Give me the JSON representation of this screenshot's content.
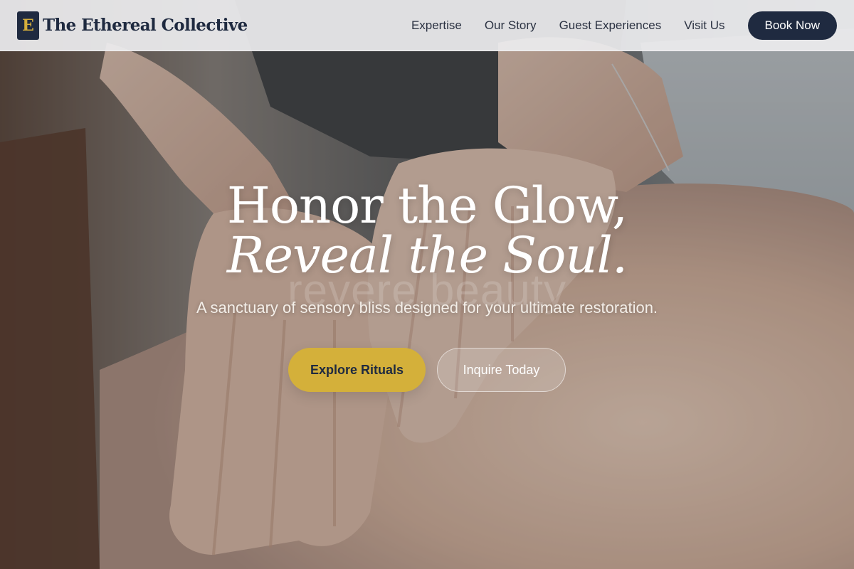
{
  "header": {
    "logo_initial": "E",
    "brand_name": "The Ethereal Collective",
    "nav_items": [
      {
        "label": "Expertise"
      },
      {
        "label": "Our Story"
      },
      {
        "label": "Guest Experiences"
      },
      {
        "label": "Visit Us"
      }
    ],
    "book_label": "Book Now"
  },
  "hero": {
    "headline_line1": "Honor the Glow,",
    "headline_line2": "Reveal the Soul.",
    "watermark": "revere beauty",
    "tagline": "A sanctuary of sensory bliss designed for your ultimate restoration.",
    "primary_cta": "Explore Rituals",
    "secondary_cta": "Inquire Today",
    "image_subject": "massage-hands-on-back-photo"
  },
  "colors": {
    "navy": "#1f2a40",
    "gold": "#d4b03a",
    "header_bg": "#ececee",
    "text_light": "#ffffff"
  }
}
